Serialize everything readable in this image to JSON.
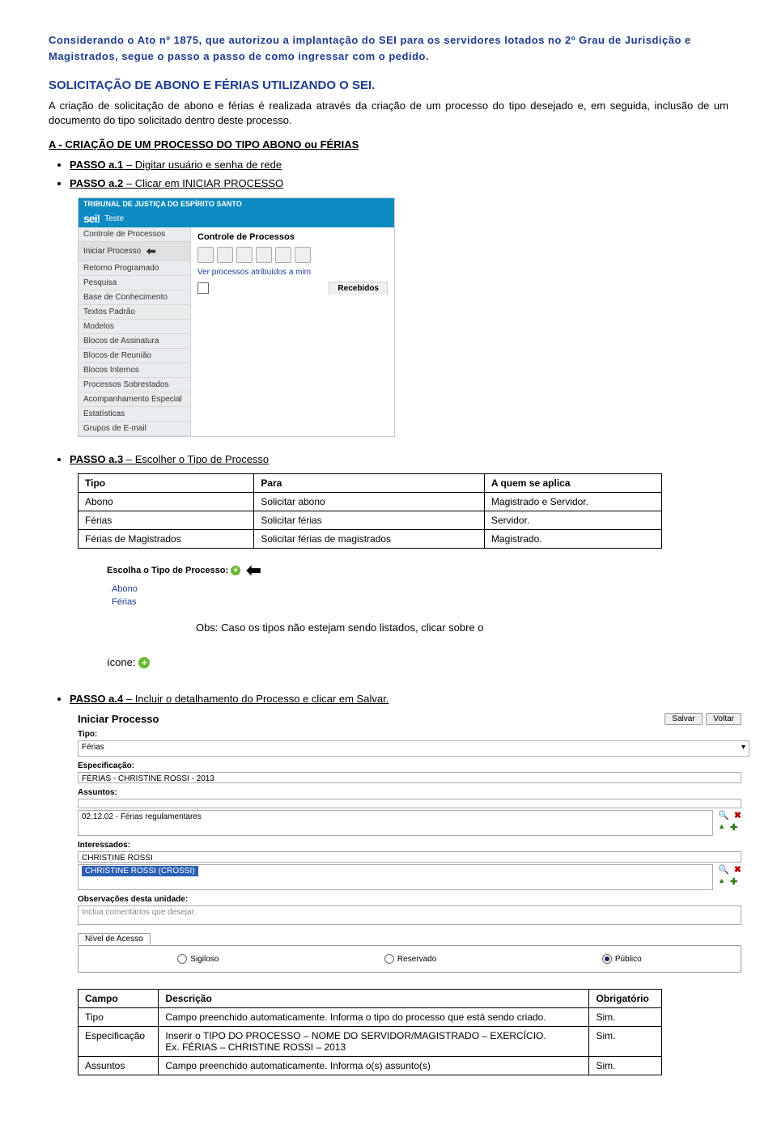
{
  "intro": "Considerando o Ato nº 1875, que autorizou a implantação do SEI para os servidores lotados no 2º Grau de Jurisdição e Magistrados, segue o passo a passo de como ingressar com o pedido.",
  "title": "SOLICITAÇÃO DE ABONO E FÉRIAS UTILIZANDO O SEI.",
  "desc": "A criação de solicitação de abono e férias é realizada através da criação de um processo do tipo desejado e, em seguida, inclusão de um documento do tipo solicitado dentro deste processo.",
  "sectionA": "A - CRIAÇÃO DE UM PROCESSO DO TIPO ABONO ou FÉRIAS",
  "pa1": {
    "label": "PASSO a.1",
    "text": " – Digitar usuário e senha de rede"
  },
  "pa2": {
    "label": "PASSO a.2",
    "text": " – Clicar em INICIAR PROCESSO"
  },
  "pa3": {
    "label": "PASSO a.3",
    "text": " – Escolher o Tipo de Processo"
  },
  "pa4": {
    "label": "PASSO a.4",
    "text": " – Incluir o detalhamento do Processo e clicar em Salvar."
  },
  "sei": {
    "top1": "TRIBUNAL DE JUSTIÇA DO ESPÍRITO SANTO",
    "brand": "sei!",
    "sub": "Teste",
    "nav": [
      "Controle de Processos",
      "Iniciar Processo",
      "Retorno Programado",
      "Pesquisa",
      "Base de Conhecimento",
      "Textos Padrão",
      "Modelos",
      "Blocos de Assinatura",
      "Blocos de Reunião",
      "Blocos Internos",
      "Processos Sobrestados",
      "Acompanhamento Especial",
      "Estatísticas",
      "Grupos de E-mail"
    ],
    "maintitle": "Controle de Processos",
    "ver": "Ver processos atribuídos a mim",
    "tab": "Recebidos"
  },
  "table_tipo": {
    "head": [
      "Tipo",
      "Para",
      "A quem se aplica"
    ],
    "rows": [
      [
        "Abono",
        "Solicitar abono",
        "Magistrado e Servidor."
      ],
      [
        "Férias",
        "Solicitar férias",
        "Servidor."
      ],
      [
        "Férias de Magistrados",
        "Solicitar férias de magistrados",
        "Magistrado."
      ]
    ]
  },
  "tipo_shot": {
    "label": "Escolha o Tipo de Processo:",
    "opts": [
      "Abono",
      "Férias"
    ]
  },
  "obs": {
    "text": "Obs: Caso os tipos não estejam sendo listados, clicar sobre o",
    "icone": "ícone:"
  },
  "form": {
    "title": "Iniciar Processo",
    "btn_salvar": "Salvar",
    "btn_voltar": "Voltar",
    "tipo_lbl": "Tipo:",
    "tipo_val": "Férias",
    "espec_lbl": "Especificação:",
    "espec_val": "FÉRIAS - CHRISTINE ROSSI - 2013",
    "assuntos_lbl": "Assuntos:",
    "assuntos_val": "02.12.02 - Férias regulamentares",
    "inter_lbl": "Interessados:",
    "inter_val1": "CHRISTINE ROSSI",
    "inter_val2": "CHRISTINE ROSSI (CROSSI)",
    "obs_lbl": "Observações desta unidade:",
    "obs_ph": "Inclua comentários que desejar.",
    "nivel_lbl": "Nível de Acesso",
    "radios": [
      "Sigiloso",
      "Reservado",
      "Público"
    ]
  },
  "table_campo": {
    "head": [
      "Campo",
      "Descrição",
      "Obrigatório"
    ],
    "rows": [
      [
        "Tipo",
        "Campo preenchido automaticamente. Informa o tipo do processo que está sendo criado.",
        "Sim."
      ],
      [
        "Especificação",
        "Inserir o TIPO DO PROCESSO – NOME DO SERVIDOR/MAGISTRADO – EXERCÍCIO.\nEx. FÉRIAS – CHRISTINE ROSSI – 2013",
        "Sim."
      ],
      [
        "Assuntos",
        "Campo preenchido automaticamente. Informa o(s) assunto(s)",
        "Sim."
      ]
    ]
  }
}
